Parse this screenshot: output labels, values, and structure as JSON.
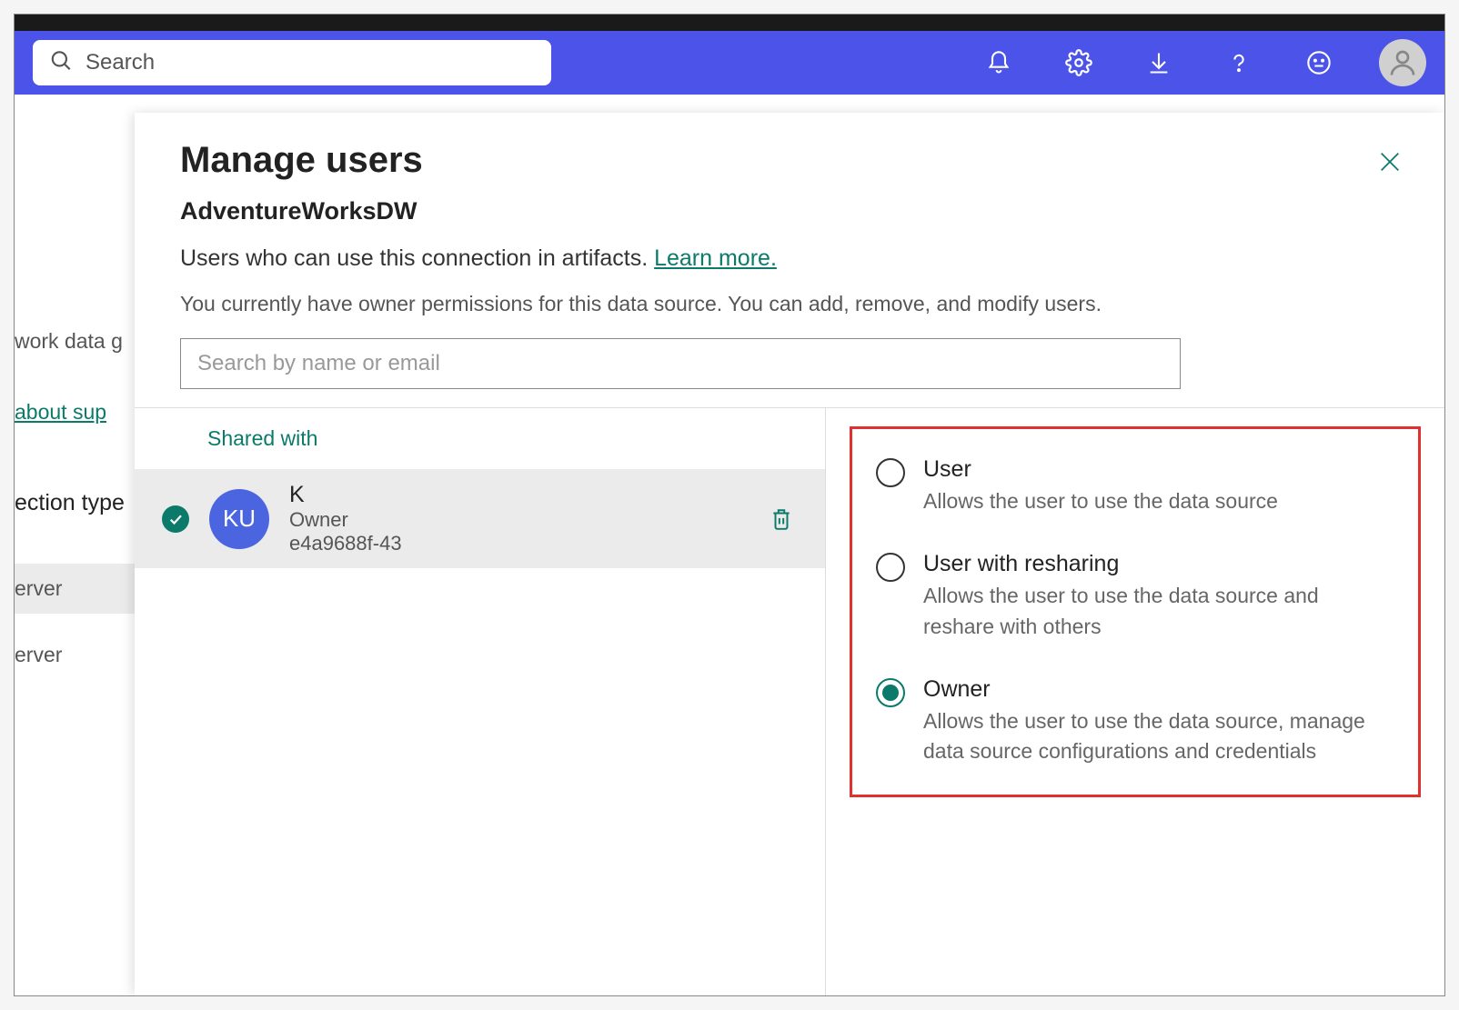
{
  "header": {
    "search_placeholder": "Search"
  },
  "behind": {
    "r1": "work data g",
    "r2": "about sup",
    "r3": "ection type",
    "r4": "erver",
    "r5": "erver"
  },
  "panel": {
    "title": "Manage users",
    "subtitle": "AdventureWorksDW",
    "desc_prefix": "Users who can use this connection in artifacts. ",
    "learn_more": "Learn more.",
    "perm_note": "You currently have owner permissions for this data source. You can add, remove, and modify users.",
    "user_search_placeholder": "Search by name or email",
    "shared_with_label": "Shared with"
  },
  "user": {
    "initials": "KU",
    "name": "K",
    "role": "Owner",
    "id": "e4a9688f-43"
  },
  "roles": [
    {
      "title": "User",
      "desc": "Allows the user to use the data source",
      "selected": false
    },
    {
      "title": "User with resharing",
      "desc": "Allows the user to use the data source and reshare with others",
      "selected": false
    },
    {
      "title": "Owner",
      "desc": "Allows the user to use the data source, manage data source configurations and credentials",
      "selected": true
    }
  ]
}
